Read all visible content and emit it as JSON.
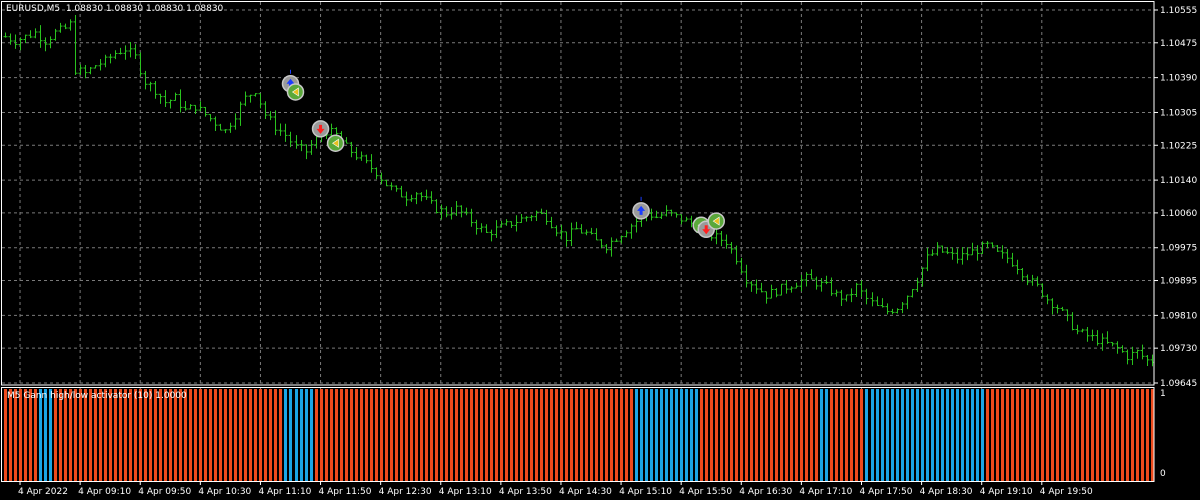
{
  "window": {
    "symbol_title": "EURUSD,M5  1.08830 1.08830 1.08830 1.08830",
    "indicator_title": "M5 Gann high/low activator (10) 1.0000"
  },
  "colors": {
    "background": "#000000",
    "grid": "#7a7a7a",
    "bars": "#29c21e",
    "hist_up": "#1aa6e6",
    "hist_down": "#ec4a1c",
    "axis_border": "#ffffff"
  },
  "chart_data": [
    {
      "type": "ohlc",
      "y_ticks": [
        "1.10555",
        "1.10475",
        "1.10390",
        "1.10305",
        "1.10225",
        "1.10140",
        "1.10060",
        "1.09975",
        "1.09895",
        "1.09810",
        "1.09730",
        "1.09645"
      ],
      "ylim": [
        1.09645,
        1.10555
      ],
      "x_tick_labels": [
        "4 Apr 2022",
        "4 Apr 09:10",
        "4 Apr 09:50",
        "4 Apr 10:30",
        "4 Apr 11:10",
        "4 Apr 11:50",
        "4 Apr 12:30",
        "4 Apr 13:10",
        "4 Apr 13:50",
        "4 Apr 14:30",
        "4 Apr 15:10",
        "4 Apr 15:50",
        "4 Apr 16:30",
        "4 Apr 17:10",
        "4 Apr 17:50",
        "4 Apr 18:30",
        "4 Apr 19:10",
        "4 Apr 19:50"
      ],
      "close_path": [
        [
          0,
          1.1049
        ],
        [
          2,
          1.1048
        ],
        [
          4,
          1.1049
        ],
        [
          6,
          1.105
        ],
        [
          8,
          1.1048
        ],
        [
          10,
          1.105
        ],
        [
          12,
          1.1051
        ],
        [
          13,
          1.1052
        ],
        [
          14,
          1.1041
        ],
        [
          16,
          1.104
        ],
        [
          18,
          1.1042
        ],
        [
          20,
          1.1043
        ],
        [
          22,
          1.1045
        ],
        [
          24,
          1.1046
        ],
        [
          26,
          1.1044
        ],
        [
          28,
          1.1038
        ],
        [
          30,
          1.1036
        ],
        [
          32,
          1.1033
        ],
        [
          34,
          1.1034
        ],
        [
          36,
          1.1031
        ],
        [
          38,
          1.1032
        ],
        [
          40,
          1.103
        ],
        [
          42,
          1.1028
        ],
        [
          44,
          1.1026
        ],
        [
          46,
          1.103
        ],
        [
          48,
          1.1034
        ],
        [
          50,
          1.1036
        ],
        [
          52,
          1.103
        ],
        [
          54,
          1.1027
        ],
        [
          56,
          1.1025
        ],
        [
          58,
          1.1022
        ],
        [
          60,
          1.1021
        ],
        [
          62,
          1.1024
        ],
        [
          64,
          1.1026
        ],
        [
          66,
          1.1025
        ],
        [
          68,
          1.1022
        ],
        [
          70,
          1.102
        ],
        [
          72,
          1.1018
        ],
        [
          74,
          1.1016
        ],
        [
          76,
          1.1013
        ],
        [
          78,
          1.1011
        ],
        [
          80,
          1.101
        ],
        [
          82,
          1.1011
        ],
        [
          84,
          1.1009
        ],
        [
          86,
          1.1007
        ],
        [
          88,
          1.1006
        ],
        [
          90,
          1.1007
        ],
        [
          92,
          1.1005
        ],
        [
          94,
          1.1003
        ],
        [
          96,
          1.1001
        ],
        [
          98,
          1.1002
        ],
        [
          100,
          1.1003
        ],
        [
          102,
          1.1004
        ],
        [
          104,
          1.1005
        ],
        [
          106,
          1.1006
        ],
        [
          108,
          1.1005
        ],
        [
          110,
          1.1002
        ],
        [
          112,
          1.1
        ],
        [
          114,
          1.1002
        ],
        [
          116,
          1.1001
        ],
        [
          118,
          1.0999
        ],
        [
          120,
          1.0998
        ],
        [
          122,
          1.1
        ],
        [
          124,
          1.1002
        ],
        [
          126,
          1.1004
        ],
        [
          128,
          1.1006
        ],
        [
          130,
          1.1005
        ],
        [
          132,
          1.1006
        ],
        [
          134,
          1.1005
        ],
        [
          136,
          1.1004
        ],
        [
          138,
          1.1003
        ],
        [
          140,
          1.1001
        ],
        [
          142,
          1.1
        ],
        [
          144,
          1.0999
        ],
        [
          146,
          1.0995
        ],
        [
          148,
          1.099
        ],
        [
          150,
          1.0988
        ],
        [
          152,
          1.0986
        ],
        [
          154,
          1.0987
        ],
        [
          156,
          1.0988
        ],
        [
          158,
          1.0989
        ],
        [
          160,
          1.099
        ],
        [
          162,
          1.0989
        ],
        [
          164,
          1.0988
        ],
        [
          166,
          1.0986
        ],
        [
          168,
          1.0985
        ],
        [
          170,
          1.0988
        ],
        [
          172,
          1.0985
        ],
        [
          174,
          1.0983
        ],
        [
          176,
          1.0982
        ],
        [
          178,
          1.0983
        ],
        [
          180,
          1.0986
        ],
        [
          182,
          1.099
        ],
        [
          184,
          1.0995
        ],
        [
          186,
          1.0997
        ],
        [
          188,
          1.0996
        ],
        [
          190,
          1.0995
        ],
        [
          192,
          1.0996
        ],
        [
          194,
          1.0997
        ],
        [
          196,
          1.0998
        ],
        [
          198,
          1.0996
        ],
        [
          200,
          1.0995
        ],
        [
          202,
          1.0993
        ],
        [
          204,
          1.099
        ],
        [
          206,
          1.0988
        ],
        [
          208,
          1.0985
        ],
        [
          210,
          1.0983
        ],
        [
          212,
          1.098
        ],
        [
          214,
          1.0977
        ],
        [
          216,
          1.0976
        ],
        [
          218,
          1.0975
        ],
        [
          220,
          1.0974
        ],
        [
          222,
          1.0973
        ],
        [
          224,
          1.0971
        ],
        [
          226,
          1.0972
        ],
        [
          228,
          1.097
        ]
      ]
    },
    {
      "type": "histogram",
      "name": "M5 Gann high/low activator (10)",
      "y_ticks": [
        "1",
        "0"
      ],
      "bar_count": 230,
      "up_runs": [
        [
          7,
          9
        ],
        [
          56,
          61
        ],
        [
          126,
          138
        ],
        [
          163,
          164
        ],
        [
          172,
          195
        ]
      ]
    }
  ],
  "signals": [
    {
      "bar": 57,
      "kind": "buy-arrow",
      "price": 1.10375
    },
    {
      "bar": 58,
      "kind": "exit-flag",
      "price": 1.10355
    },
    {
      "bar": 63,
      "kind": "sell-arrow",
      "price": 1.10265
    },
    {
      "bar": 66,
      "kind": "exit-flag",
      "price": 1.1023
    },
    {
      "bar": 127,
      "kind": "buy-arrow",
      "price": 1.10065
    },
    {
      "bar": 139,
      "kind": "exit-flag",
      "price": 1.1003
    },
    {
      "bar": 140,
      "kind": "sell-arrow",
      "price": 1.1002
    },
    {
      "bar": 142,
      "kind": "exit-flag",
      "price": 1.1004
    }
  ]
}
